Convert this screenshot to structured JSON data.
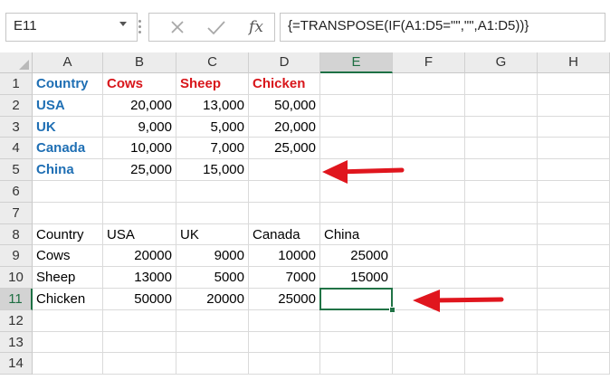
{
  "name_box": "E11",
  "formula_bar": {
    "cancel_icon": "x-icon",
    "enter_icon": "check-icon",
    "function_label": "fx",
    "formula": "{=TRANSPOSE(IF(A1:D5=\"\",\"\",A1:D5))}"
  },
  "columns": [
    "A",
    "B",
    "C",
    "D",
    "E",
    "F",
    "G",
    "H"
  ],
  "rows": [
    "1",
    "2",
    "3",
    "4",
    "5",
    "6",
    "7",
    "8",
    "9",
    "10",
    "11",
    "12",
    "13",
    "14"
  ],
  "selected_cell": "E11",
  "cells": {
    "A1": "Country",
    "B1": "Cows",
    "C1": "Sheep",
    "D1": "Chicken",
    "A2": "USA",
    "B2": "20,000",
    "C2": "13,000",
    "D2": "50,000",
    "A3": "UK",
    "B3": "9,000",
    "C3": "5,000",
    "D3": "20,000",
    "A4": "Canada",
    "B4": "10,000",
    "C4": "7,000",
    "D4": "25,000",
    "A5": "China",
    "B5": "25,000",
    "C5": "15,000",
    "A8": "Country",
    "B8": "USA",
    "C8": "UK",
    "D8": "Canada",
    "E8": "China",
    "A9": "Cows",
    "B9": "20000",
    "C9": "9000",
    "D9": "10000",
    "E9": "25000",
    "A10": "Sheep",
    "B10": "13000",
    "C10": "5000",
    "D10": "7000",
    "E10": "15000",
    "A11": "Chicken",
    "B11": "50000",
    "C11": "20000",
    "D11": "25000"
  },
  "colors": {
    "header_blue": "#1f6fb4",
    "header_red": "#d8161b",
    "selection_green": "#217346",
    "arrow_red": "#e0161e"
  }
}
